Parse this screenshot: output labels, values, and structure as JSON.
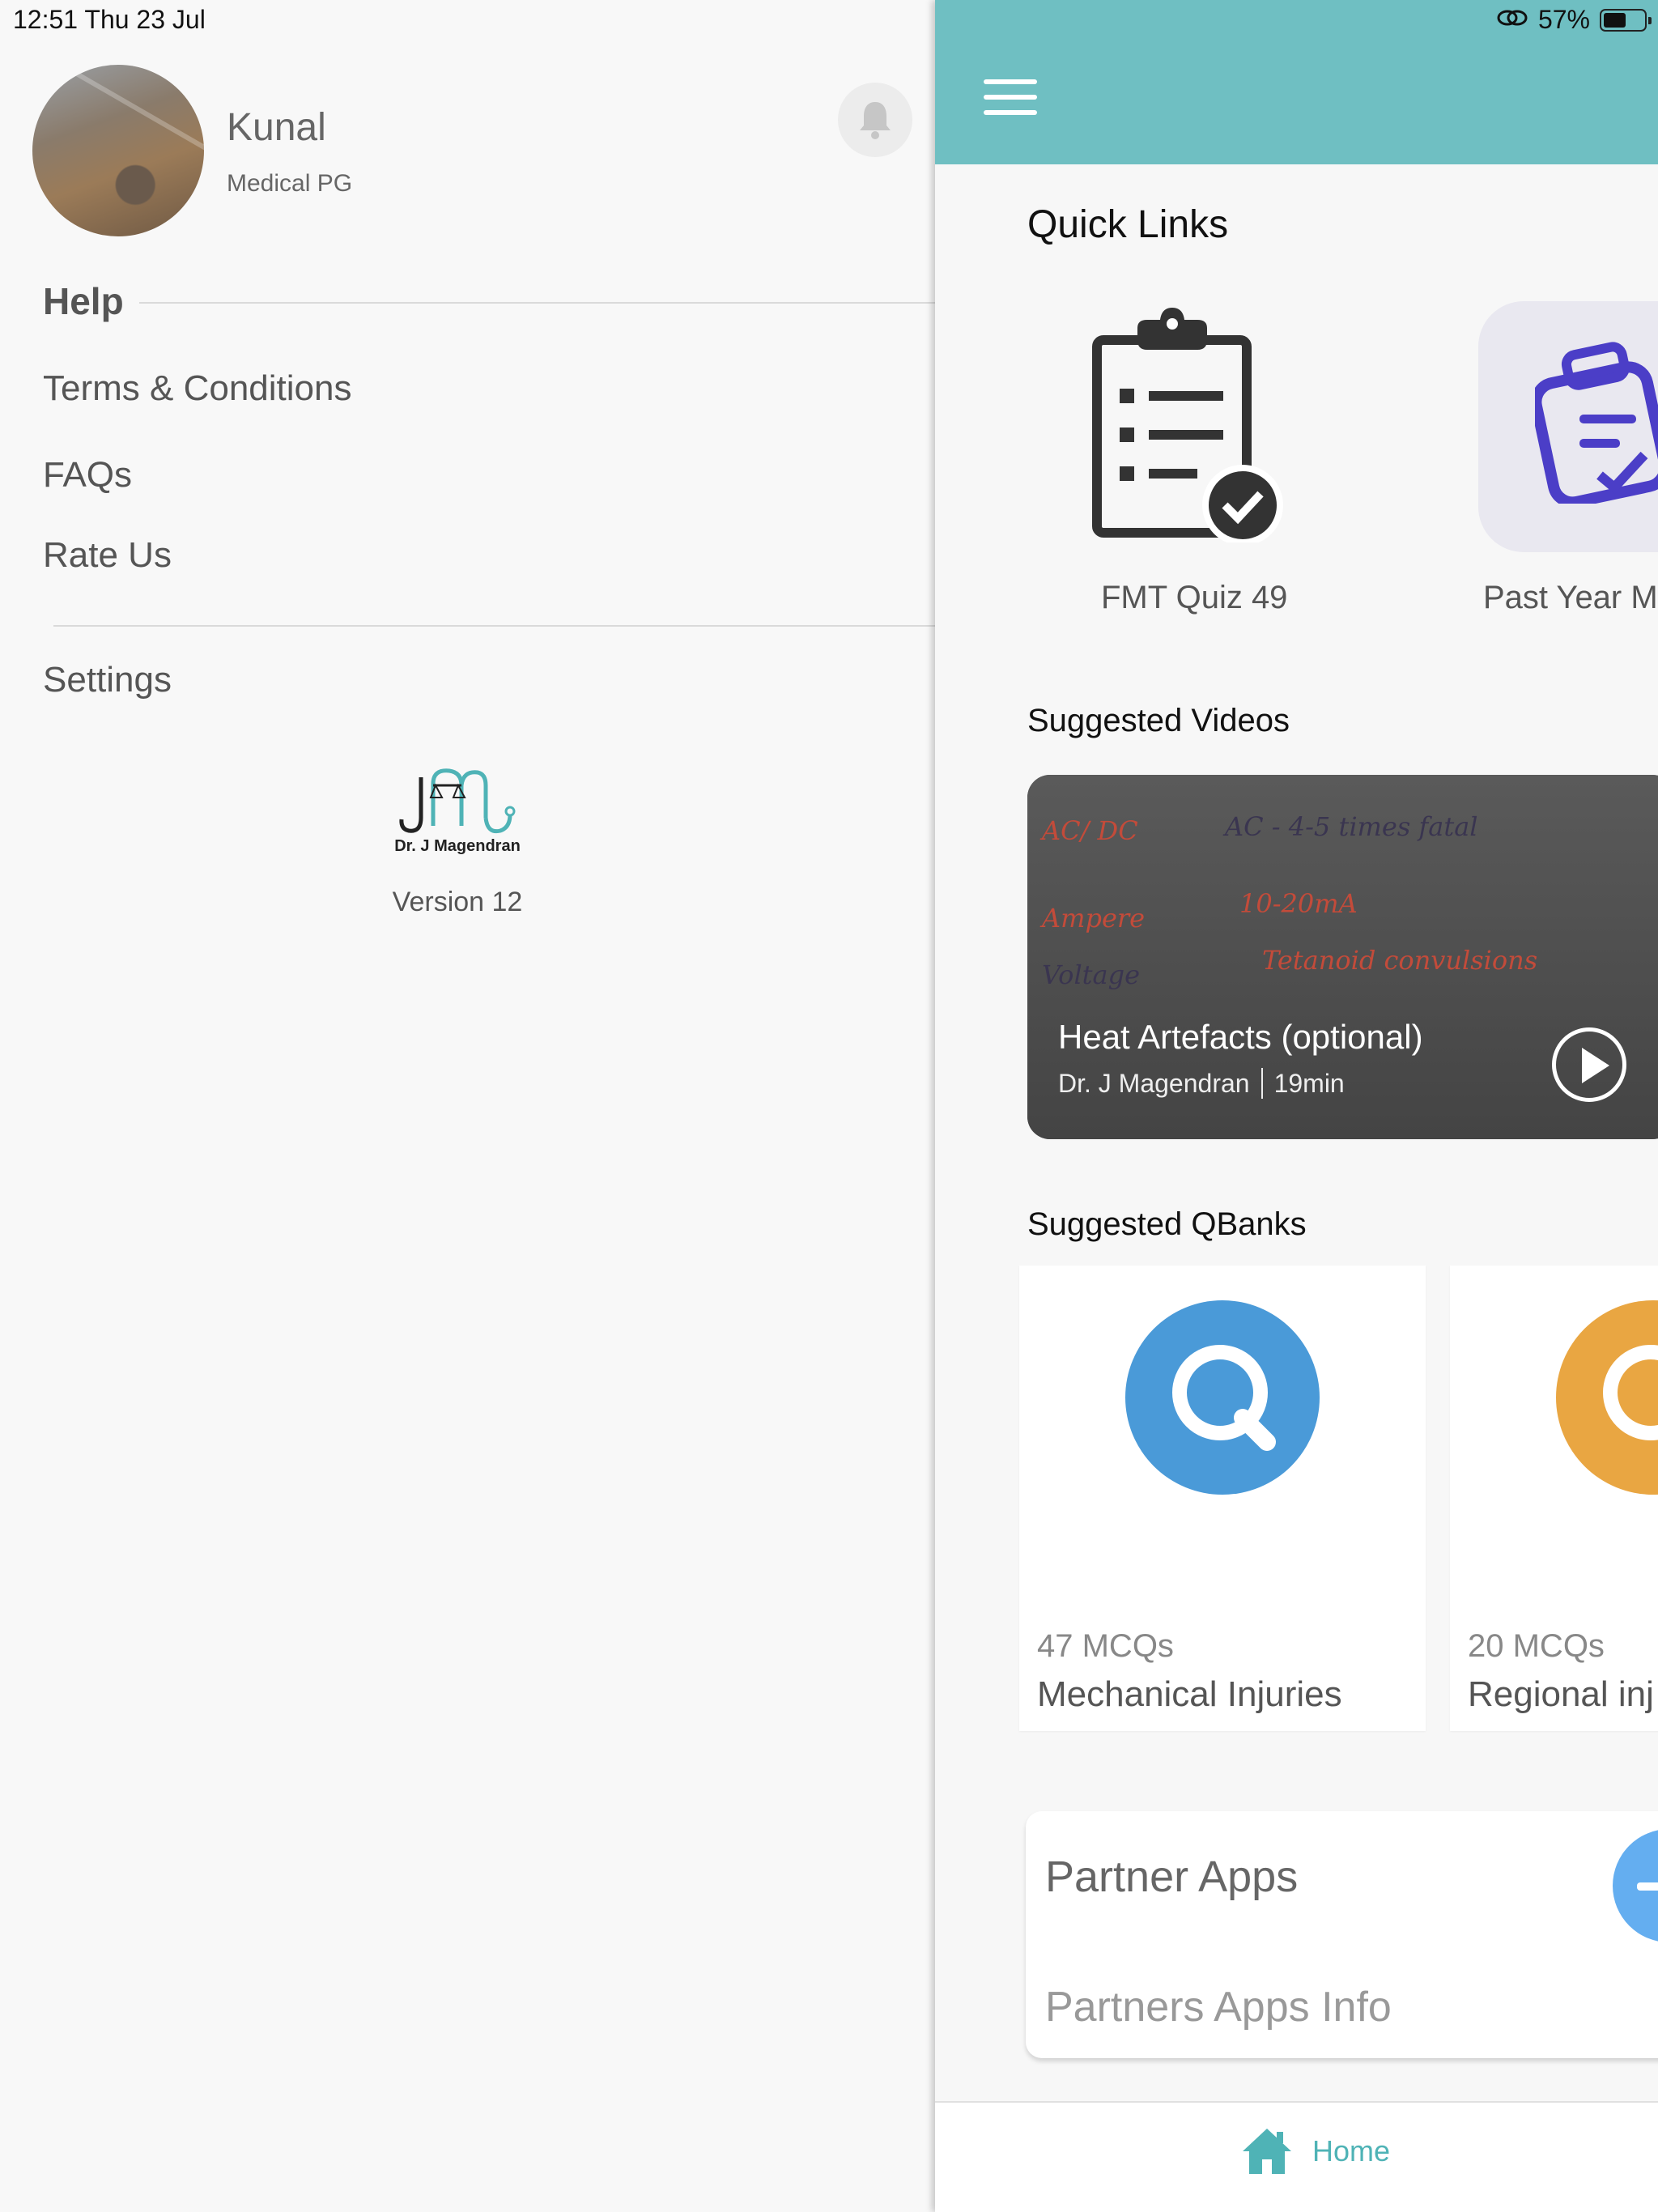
{
  "status_bar": {
    "time_date": "12:51   Thu 23 Jul",
    "battery": "57%",
    "battery_level": 0.57
  },
  "drawer": {
    "user": {
      "name": "Kunal",
      "role": "Medical PG"
    },
    "help_heading": "Help",
    "items": [
      {
        "label": "Terms & Conditions"
      },
      {
        "label": "FAQs"
      },
      {
        "label": "Rate Us"
      }
    ],
    "settings_label": "Settings",
    "logo_text": "Dr. J Magendran",
    "version": "Version 12"
  },
  "main": {
    "quick_links": {
      "title": "Quick Links",
      "items": [
        {
          "label": "FMT Quiz 49",
          "icon": "clipboard-check-icon"
        },
        {
          "label": "Past Year M",
          "icon": "clipboard-edit-icon"
        }
      ]
    },
    "suggested_videos": {
      "title": "Suggested Videos",
      "video": {
        "title": "Heat Artefacts (optional)",
        "author": "Dr. J Magendran",
        "duration": "19min",
        "board_text": [
          "AC/ DC",
          "AC - 4-5 times fatal",
          "Ampere",
          "10-20mA",
          "Voltage",
          "Tetanoid convulsions"
        ]
      }
    },
    "suggested_qbanks": {
      "title": "Suggested QBanks",
      "cards": [
        {
          "count": "47 MCQs",
          "name": "Mechanical Injuries",
          "color": "#4a9ad8"
        },
        {
          "count": "20 MCQs",
          "name": "Regional inj",
          "color": "#e9a642"
        }
      ]
    },
    "partner_apps": {
      "title": "Partner Apps",
      "subtitle": "Partners Apps Info"
    },
    "tab_bar": {
      "home_label": "Home"
    }
  },
  "colors": {
    "accent": "#6fbfc2",
    "tab_active": "#4fb3b6",
    "quick_link_purple": "#4b3ec7"
  }
}
